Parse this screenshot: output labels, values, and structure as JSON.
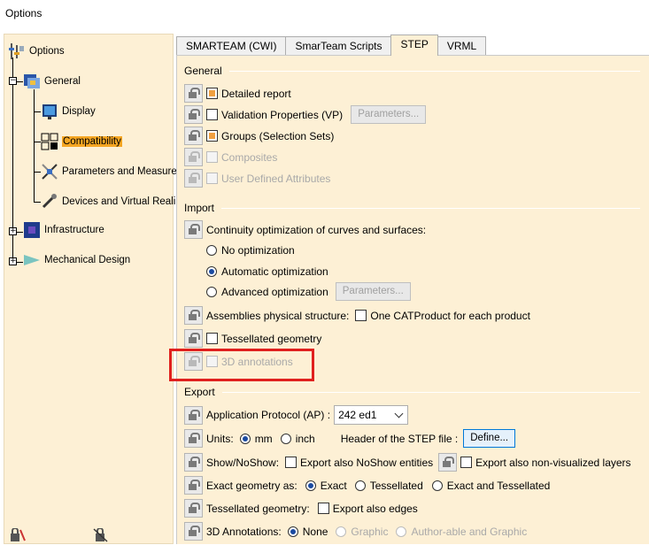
{
  "window": {
    "title": "Options"
  },
  "tree": {
    "root": "Options",
    "items": [
      {
        "label": "General"
      },
      {
        "label": "Display"
      },
      {
        "label": "Compatibility"
      },
      {
        "label": "Parameters and Measure"
      },
      {
        "label": "Devices and Virtual Reali"
      },
      {
        "label": "Infrastructure"
      },
      {
        "label": "Mechanical Design"
      }
    ]
  },
  "tabs": [
    {
      "label": "SMARTEAM (CWI)"
    },
    {
      "label": "SmarTeam Scripts"
    },
    {
      "label": "STEP"
    },
    {
      "label": "VRML"
    }
  ],
  "general": {
    "title": "General",
    "detailed_report": "Detailed report",
    "validation_properties": "Validation Properties (VP)",
    "parameters_btn": "Parameters...",
    "groups": "Groups (Selection Sets)",
    "composites": "Composites",
    "user_defined": "User Defined Attributes"
  },
  "import": {
    "title": "Import",
    "continuity": "Continuity optimization of curves and surfaces:",
    "no_opt": "No optimization",
    "auto_opt": "Automatic optimization",
    "adv_opt": "Advanced optimization",
    "parameters_btn": "Parameters...",
    "assemblies": "Assemblies physical structure:",
    "one_catproduct": "One CATProduct for each product",
    "tessellated": "Tessellated geometry",
    "annotations_3d": "3D annotations"
  },
  "export": {
    "title": "Export",
    "ap_label": "Application Protocol (AP) :",
    "ap_value": "242 ed1",
    "units_label": "Units:",
    "unit_mm": "mm",
    "unit_inch": "inch",
    "header_label": "Header of the STEP file :",
    "define_btn": "Define...",
    "show_noshow": "Show/NoShow:",
    "export_noshow": "Export also NoShow entities",
    "export_nonvisual": "Export also non-visualized layers",
    "exact_geom": "Exact geometry as:",
    "exact": "Exact",
    "tessellated": "Tessellated",
    "exact_and_tess": "Exact and Tessellated",
    "tess_geom": "Tessellated geometry:",
    "export_edges": "Export also edges",
    "annot_3d": "3D Annotations:",
    "none": "None",
    "graphic": "Graphic",
    "authorable": "Author-able and Graphic"
  },
  "colors": {
    "panel_bg": "#fdf0d5",
    "selection": "#f5a623",
    "highlight_box": "#e0201e"
  }
}
